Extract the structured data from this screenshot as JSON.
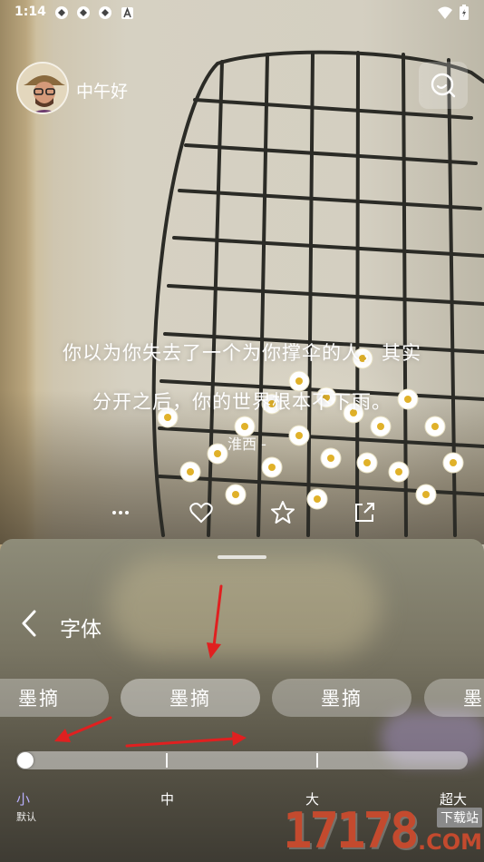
{
  "status_bar": {
    "time": "1:14",
    "notification_icons": [
      "app-icon",
      "app-icon",
      "app-icon",
      "a-icon"
    ],
    "right_icons": [
      "wifi-icon",
      "battery-icon"
    ]
  },
  "header": {
    "greeting": "中午好",
    "avatar": "avatar",
    "search_icon": "search-icon"
  },
  "quote": {
    "line1": "你以为你失去了一个为你撑伞的人，其实",
    "line2": "分开之后，你的世界根本不下雨。",
    "author": "- 淮西 -"
  },
  "actions": [
    "more-icon",
    "heart-icon",
    "star-icon",
    "share-icon"
  ],
  "font_sheet": {
    "title": "字体",
    "font_options": [
      {
        "label": "墨摘"
      },
      {
        "label": "墨摘"
      },
      {
        "label": "墨摘"
      },
      {
        "label": "墨"
      }
    ],
    "size_labels": [
      {
        "label": "小",
        "sub": "默认"
      },
      {
        "label": "中"
      },
      {
        "label": "大"
      },
      {
        "label": "超大"
      }
    ],
    "slider_value": 0,
    "active_color": "#b9b0ff"
  },
  "watermark": {
    "number": "17178",
    "tag": "下载站",
    "domain": ".COM"
  },
  "colors": {
    "annotation_arrow": "#e02020",
    "watermark": "#c44a2e"
  }
}
